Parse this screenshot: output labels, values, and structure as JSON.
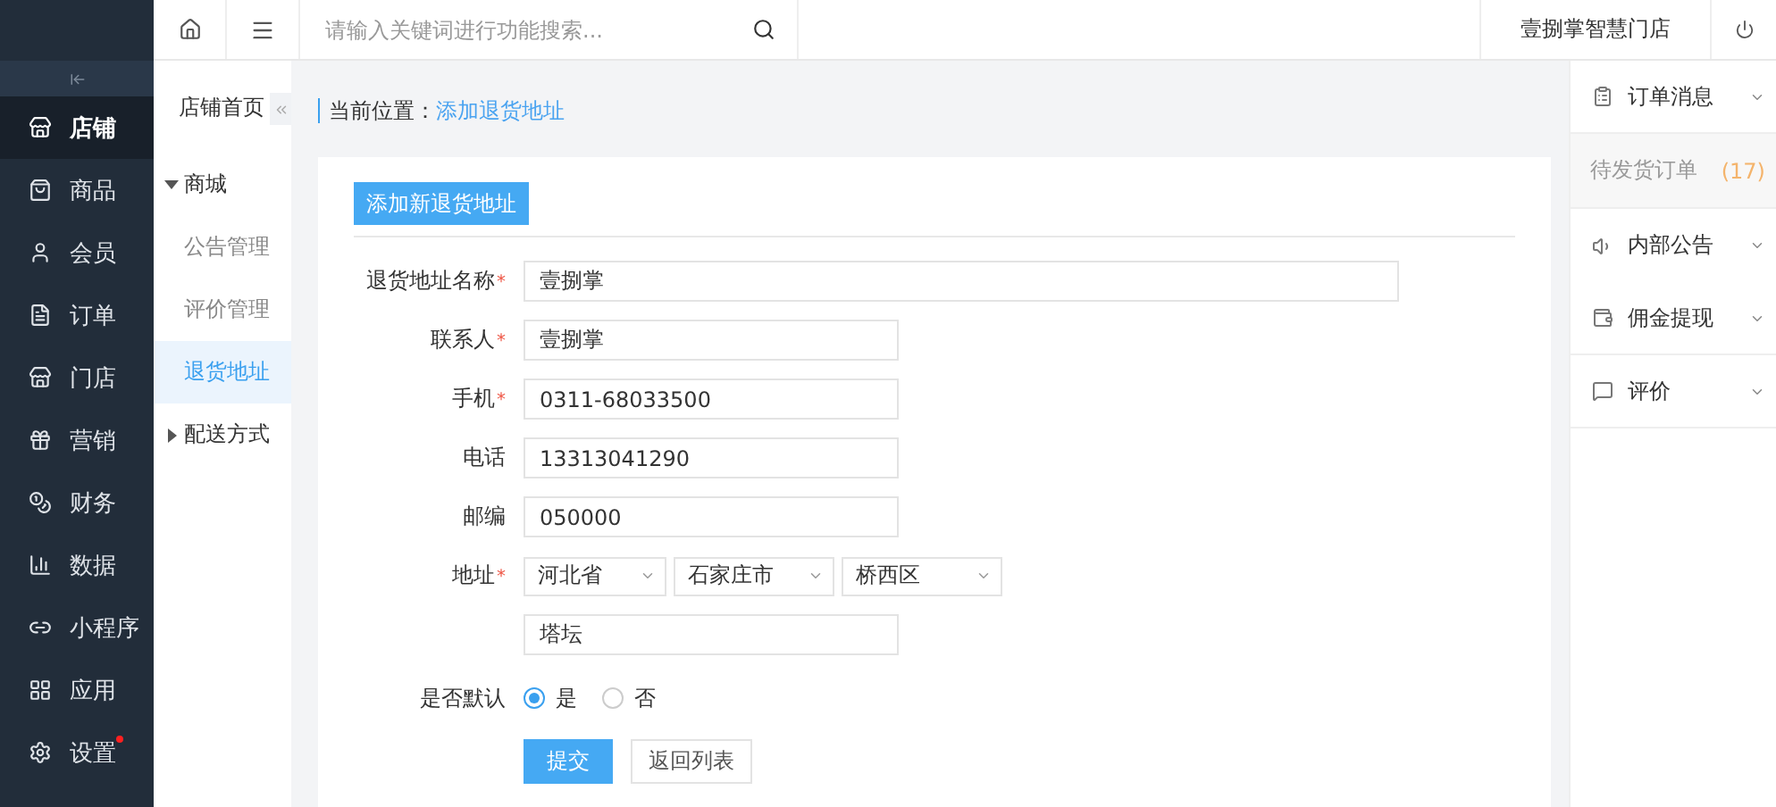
{
  "topbar": {
    "search": {
      "placeholder": "请输入关键词进行功能搜索..."
    },
    "store_name": "壹捌掌智慧门店"
  },
  "sidebar": {
    "items": [
      {
        "label": "店铺",
        "selected": true,
        "dot": false
      },
      {
        "label": "商品",
        "selected": false,
        "dot": false
      },
      {
        "label": "会员",
        "selected": false,
        "dot": false
      },
      {
        "label": "订单",
        "selected": false,
        "dot": false
      },
      {
        "label": "门店",
        "selected": false,
        "dot": false
      },
      {
        "label": "营销",
        "selected": false,
        "dot": false
      },
      {
        "label": "财务",
        "selected": false,
        "dot": false
      },
      {
        "label": "数据",
        "selected": false,
        "dot": false
      },
      {
        "label": "小程序",
        "selected": false,
        "dot": false
      },
      {
        "label": "应用",
        "selected": false,
        "dot": false
      },
      {
        "label": "设置",
        "selected": false,
        "dot": true
      }
    ]
  },
  "subnav": {
    "title": "店铺首页",
    "groups": [
      {
        "label": "商城",
        "expanded": true,
        "children": [
          {
            "label": "公告管理",
            "selected": false
          },
          {
            "label": "评价管理",
            "selected": false
          },
          {
            "label": "退货地址",
            "selected": true
          }
        ]
      },
      {
        "label": "配送方式",
        "expanded": false
      }
    ]
  },
  "breadcrumb": {
    "prefix": "当前位置：",
    "current": "添加退货地址"
  },
  "tab_button": "添加新退货地址",
  "form": {
    "fields": [
      {
        "kind": "text",
        "label": "退货地址名称",
        "required_mark": "*",
        "value": "壹捌掌",
        "wide": true
      },
      {
        "kind": "text",
        "label": "联系人",
        "required_mark": "*",
        "value": "壹捌掌",
        "wide": false
      },
      {
        "kind": "text",
        "label": "手机",
        "required_mark": "*",
        "value": "0311-68033500",
        "wide": false
      },
      {
        "kind": "text",
        "label": "电话",
        "value": "13313041290",
        "wide": false
      },
      {
        "kind": "text",
        "label": "邮编",
        "value": "050000",
        "wide": false
      },
      {
        "kind": "select",
        "label": "地址",
        "required_mark": "*",
        "options": [
          "河北省",
          "石家庄市",
          "桥西区"
        ]
      },
      {
        "kind": "text",
        "value": "塔坛",
        "wide": false
      },
      {
        "kind": "radio",
        "label": "是否默认",
        "choices": [
          {
            "label": "是",
            "selected": true
          },
          {
            "label": "否",
            "selected": false
          }
        ]
      }
    ],
    "buttons": [
      {
        "label": "提交",
        "kind": "primary"
      },
      {
        "label": "返回列表",
        "kind": "default"
      }
    ]
  },
  "right_panel": {
    "sections": [
      {
        "label": "订单消息",
        "children": [
          {
            "label": "待发货订单",
            "count": "(17)"
          }
        ]
      },
      {
        "label": "内部公告"
      },
      {
        "label": "佣金提现"
      },
      {
        "label": "评价"
      }
    ]
  }
}
